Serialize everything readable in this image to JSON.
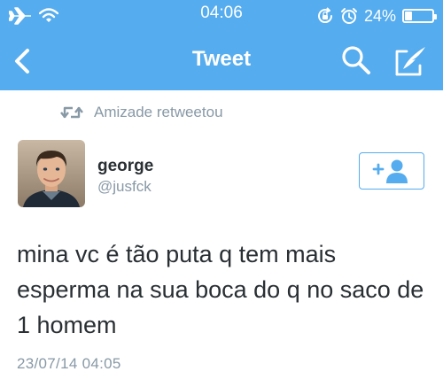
{
  "status_bar": {
    "time": "04:06",
    "battery_percent": "24%",
    "battery_level": 0.24,
    "icons": [
      "airplane-icon",
      "wifi-icon",
      "rotation-lock-icon",
      "alarm-icon",
      "battery-icon"
    ]
  },
  "nav": {
    "title": "Tweet",
    "icons": [
      "back-chevron-icon",
      "search-icon",
      "compose-icon"
    ]
  },
  "retweet": {
    "text": "Amizade retweetou",
    "icon": "retweet-icon"
  },
  "author": {
    "name": "george",
    "handle": "@jusfck",
    "follow_icon": "follow-user-icon"
  },
  "tweet": {
    "text": "mina vc é tão puta q tem mais esperma na sua boca do q no saco de 1 homem",
    "timestamp": "23/07/14 04:05"
  },
  "colors": {
    "brand": "#55acee",
    "text": "#292f33",
    "secondary": "#8899a6"
  }
}
